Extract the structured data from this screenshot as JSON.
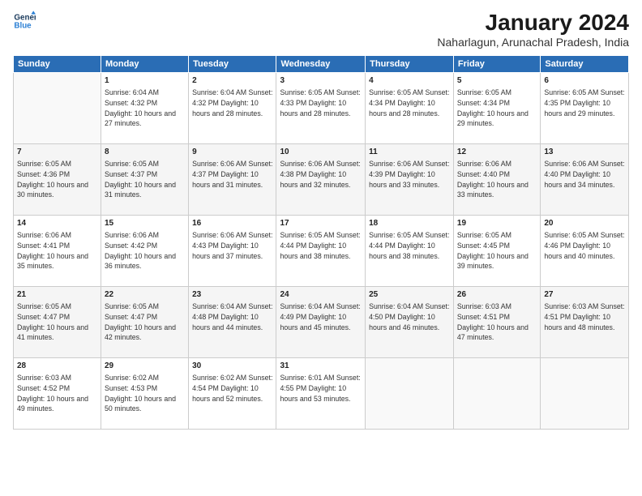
{
  "logo": {
    "line1": "General",
    "line2": "Blue"
  },
  "title": "January 2024",
  "subtitle": "Naharlagun, Arunachal Pradesh, India",
  "days_of_week": [
    "Sunday",
    "Monday",
    "Tuesday",
    "Wednesday",
    "Thursday",
    "Friday",
    "Saturday"
  ],
  "weeks": [
    [
      {
        "day": "",
        "info": ""
      },
      {
        "day": "1",
        "info": "Sunrise: 6:04 AM\nSunset: 4:32 PM\nDaylight: 10 hours\nand 27 minutes."
      },
      {
        "day": "2",
        "info": "Sunrise: 6:04 AM\nSunset: 4:32 PM\nDaylight: 10 hours\nand 28 minutes."
      },
      {
        "day": "3",
        "info": "Sunrise: 6:05 AM\nSunset: 4:33 PM\nDaylight: 10 hours\nand 28 minutes."
      },
      {
        "day": "4",
        "info": "Sunrise: 6:05 AM\nSunset: 4:34 PM\nDaylight: 10 hours\nand 28 minutes."
      },
      {
        "day": "5",
        "info": "Sunrise: 6:05 AM\nSunset: 4:34 PM\nDaylight: 10 hours\nand 29 minutes."
      },
      {
        "day": "6",
        "info": "Sunrise: 6:05 AM\nSunset: 4:35 PM\nDaylight: 10 hours\nand 29 minutes."
      }
    ],
    [
      {
        "day": "7",
        "info": "Sunrise: 6:05 AM\nSunset: 4:36 PM\nDaylight: 10 hours\nand 30 minutes."
      },
      {
        "day": "8",
        "info": "Sunrise: 6:05 AM\nSunset: 4:37 PM\nDaylight: 10 hours\nand 31 minutes."
      },
      {
        "day": "9",
        "info": "Sunrise: 6:06 AM\nSunset: 4:37 PM\nDaylight: 10 hours\nand 31 minutes."
      },
      {
        "day": "10",
        "info": "Sunrise: 6:06 AM\nSunset: 4:38 PM\nDaylight: 10 hours\nand 32 minutes."
      },
      {
        "day": "11",
        "info": "Sunrise: 6:06 AM\nSunset: 4:39 PM\nDaylight: 10 hours\nand 33 minutes."
      },
      {
        "day": "12",
        "info": "Sunrise: 6:06 AM\nSunset: 4:40 PM\nDaylight: 10 hours\nand 33 minutes."
      },
      {
        "day": "13",
        "info": "Sunrise: 6:06 AM\nSunset: 4:40 PM\nDaylight: 10 hours\nand 34 minutes."
      }
    ],
    [
      {
        "day": "14",
        "info": "Sunrise: 6:06 AM\nSunset: 4:41 PM\nDaylight: 10 hours\nand 35 minutes."
      },
      {
        "day": "15",
        "info": "Sunrise: 6:06 AM\nSunset: 4:42 PM\nDaylight: 10 hours\nand 36 minutes."
      },
      {
        "day": "16",
        "info": "Sunrise: 6:06 AM\nSunset: 4:43 PM\nDaylight: 10 hours\nand 37 minutes."
      },
      {
        "day": "17",
        "info": "Sunrise: 6:05 AM\nSunset: 4:44 PM\nDaylight: 10 hours\nand 38 minutes."
      },
      {
        "day": "18",
        "info": "Sunrise: 6:05 AM\nSunset: 4:44 PM\nDaylight: 10 hours\nand 38 minutes."
      },
      {
        "day": "19",
        "info": "Sunrise: 6:05 AM\nSunset: 4:45 PM\nDaylight: 10 hours\nand 39 minutes."
      },
      {
        "day": "20",
        "info": "Sunrise: 6:05 AM\nSunset: 4:46 PM\nDaylight: 10 hours\nand 40 minutes."
      }
    ],
    [
      {
        "day": "21",
        "info": "Sunrise: 6:05 AM\nSunset: 4:47 PM\nDaylight: 10 hours\nand 41 minutes."
      },
      {
        "day": "22",
        "info": "Sunrise: 6:05 AM\nSunset: 4:47 PM\nDaylight: 10 hours\nand 42 minutes."
      },
      {
        "day": "23",
        "info": "Sunrise: 6:04 AM\nSunset: 4:48 PM\nDaylight: 10 hours\nand 44 minutes."
      },
      {
        "day": "24",
        "info": "Sunrise: 6:04 AM\nSunset: 4:49 PM\nDaylight: 10 hours\nand 45 minutes."
      },
      {
        "day": "25",
        "info": "Sunrise: 6:04 AM\nSunset: 4:50 PM\nDaylight: 10 hours\nand 46 minutes."
      },
      {
        "day": "26",
        "info": "Sunrise: 6:03 AM\nSunset: 4:51 PM\nDaylight: 10 hours\nand 47 minutes."
      },
      {
        "day": "27",
        "info": "Sunrise: 6:03 AM\nSunset: 4:51 PM\nDaylight: 10 hours\nand 48 minutes."
      }
    ],
    [
      {
        "day": "28",
        "info": "Sunrise: 6:03 AM\nSunset: 4:52 PM\nDaylight: 10 hours\nand 49 minutes."
      },
      {
        "day": "29",
        "info": "Sunrise: 6:02 AM\nSunset: 4:53 PM\nDaylight: 10 hours\nand 50 minutes."
      },
      {
        "day": "30",
        "info": "Sunrise: 6:02 AM\nSunset: 4:54 PM\nDaylight: 10 hours\nand 52 minutes."
      },
      {
        "day": "31",
        "info": "Sunrise: 6:01 AM\nSunset: 4:55 PM\nDaylight: 10 hours\nand 53 minutes."
      },
      {
        "day": "",
        "info": ""
      },
      {
        "day": "",
        "info": ""
      },
      {
        "day": "",
        "info": ""
      }
    ]
  ]
}
